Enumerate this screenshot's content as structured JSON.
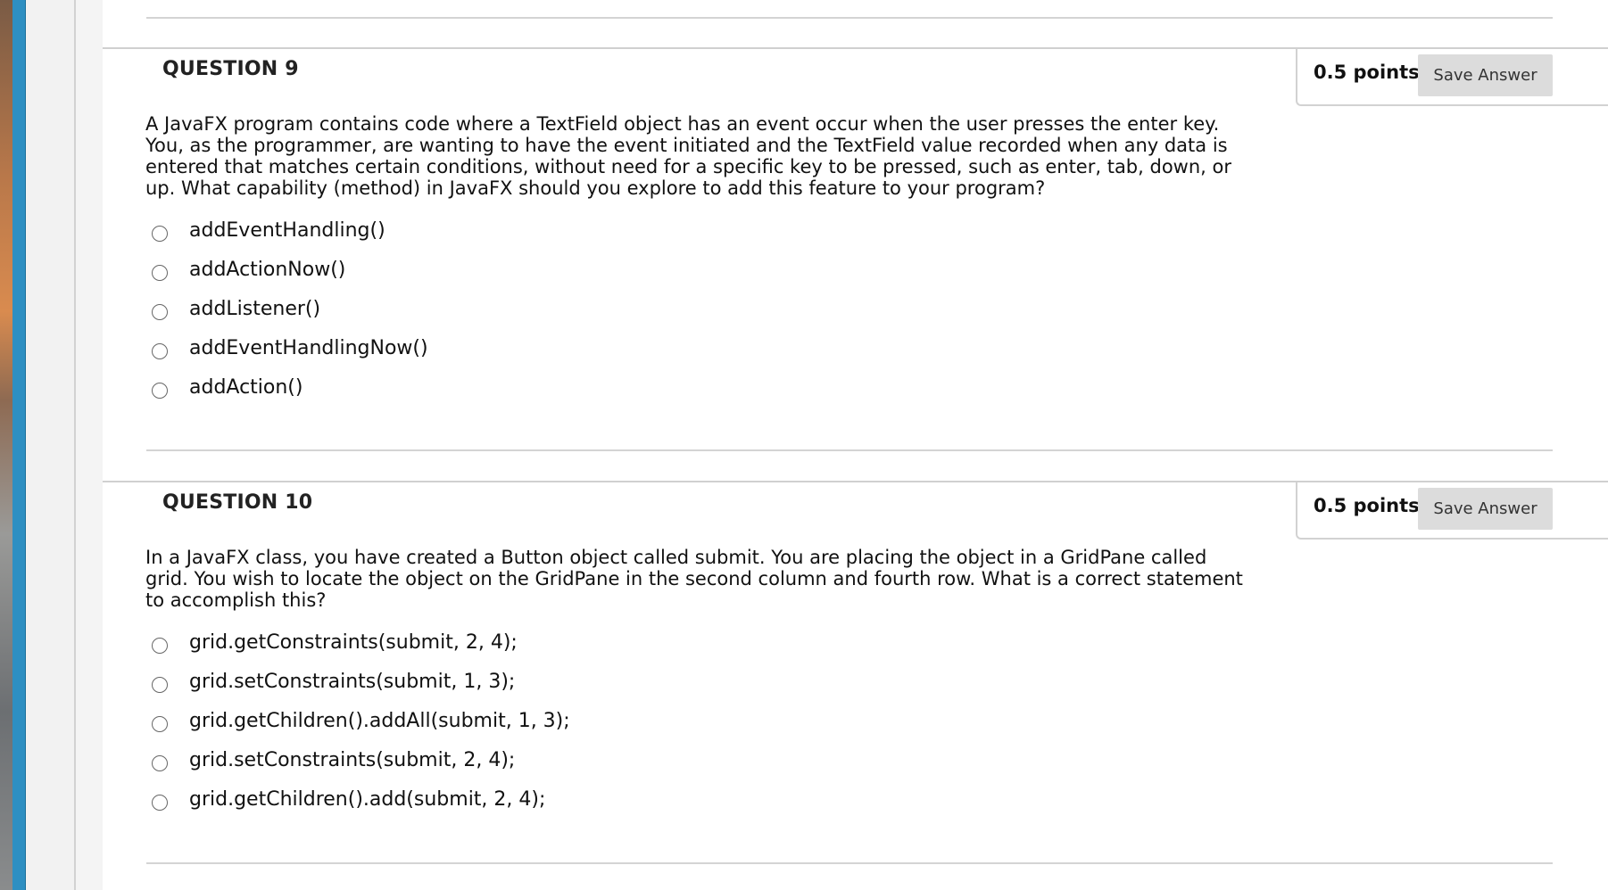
{
  "questions": [
    {
      "title": "QUESTION 9",
      "points": "0.5 points",
      "save_label": "Save Answer",
      "text": "A JavaFX program contains code where a TextField object has an event occur when the user presses the enter key.  You, as the programmer, are wanting to have the event initiated and the TextField value recorded when any data is entered that matches certain conditions, without need for a specific key to be pressed, such as enter, tab, down, or up.  What capability (method) in JavaFX should you explore to add this feature to your program?",
      "options": [
        "addEventHandling()",
        "addActionNow()",
        "addListener()",
        "addEventHandlingNow()",
        "addAction()"
      ]
    },
    {
      "title": "QUESTION 10",
      "points": "0.5 points",
      "save_label": "Save Answer",
      "text": "In a JavaFX class, you have created a Button object called submit.  You are placing the object in a GridPane called grid.  You wish to locate the object on the GridPane in the second column and fourth row.  What is a correct statement to accomplish this?",
      "options": [
        "grid.getConstraints(submit, 2, 4);",
        "grid.setConstraints(submit, 1, 3);",
        "grid.getChildren().addAll(submit, 1, 3);",
        "grid.setConstraints(submit, 2, 4);",
        "grid.getChildren().add(submit, 2, 4);"
      ]
    }
  ]
}
